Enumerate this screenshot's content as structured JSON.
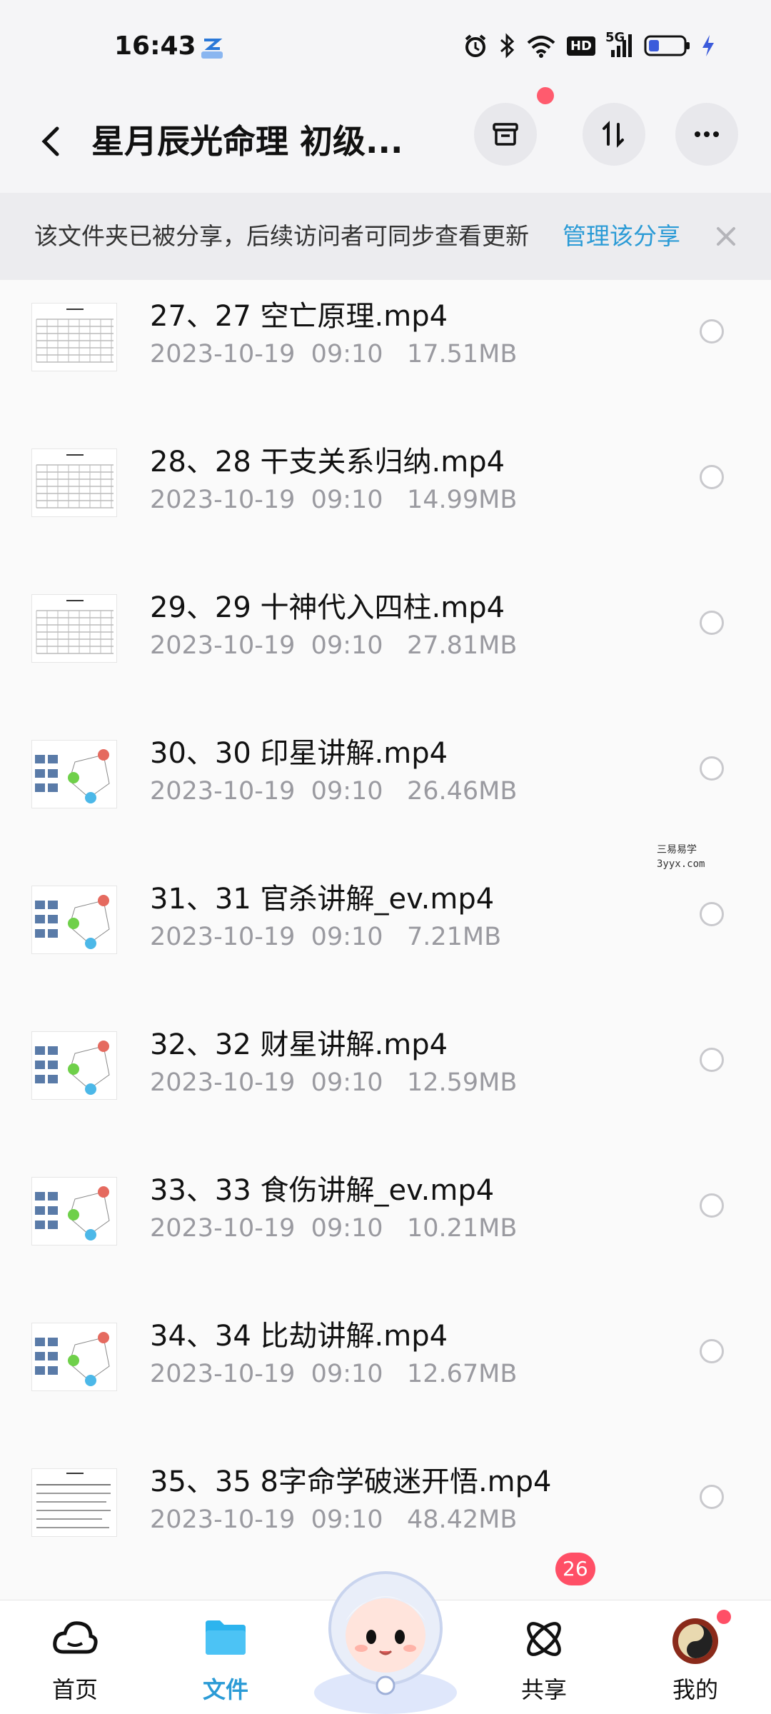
{
  "status_bar": {
    "time": "16:43",
    "icons": [
      "app-icon",
      "alarm-icon",
      "bluetooth-icon",
      "wifi-icon",
      "hd-icon",
      "5g-signal-icon",
      "battery-icon",
      "charging-icon"
    ],
    "hd_text": "HD",
    "network_text": "5G"
  },
  "header": {
    "title": "星月辰光命理 初级...",
    "icons": [
      "back-icon",
      "archive-icon",
      "sort-icon",
      "more-icon"
    ]
  },
  "banner": {
    "text": "该文件夹已被分享，后续访问者可同步查看更新",
    "link": "管理该分享",
    "close_icon": "close-icon"
  },
  "files": [
    {
      "name": "27、27 空亡原理.mp4",
      "date": "2023-10-19",
      "time": "09:10",
      "size": "17.51MB",
      "thumb": "table-thumb"
    },
    {
      "name": "28、28 干支关系归纳.mp4",
      "date": "2023-10-19",
      "time": "09:10",
      "size": "14.99MB",
      "thumb": "table-thumb"
    },
    {
      "name": "29、29 十神代入四柱.mp4",
      "date": "2023-10-19",
      "time": "09:10",
      "size": "27.81MB",
      "thumb": "table-thumb"
    },
    {
      "name": "30、30 印星讲解.mp4",
      "date": "2023-10-19",
      "time": "09:10",
      "size": "26.46MB",
      "thumb": "diagram-thumb"
    },
    {
      "name": "31、31 官杀讲解_ev.mp4",
      "date": "2023-10-19",
      "time": "09:10",
      "size": "7.21MB",
      "thumb": "diagram-thumb"
    },
    {
      "name": "32、32 财星讲解.mp4",
      "date": "2023-10-19",
      "time": "09:10",
      "size": "12.59MB",
      "thumb": "diagram-thumb"
    },
    {
      "name": "33、33 食伤讲解_ev.mp4",
      "date": "2023-10-19",
      "time": "09:10",
      "size": "10.21MB",
      "thumb": "diagram-thumb"
    },
    {
      "name": "34、34 比劫讲解.mp4",
      "date": "2023-10-19",
      "time": "09:10",
      "size": "12.67MB",
      "thumb": "diagram-thumb"
    },
    {
      "name": "35、35 8字命学破迷开悟.mp4",
      "date": "2023-10-19",
      "time": "09:10",
      "size": "48.42MB",
      "thumb": "text-thumb"
    }
  ],
  "watermark": {
    "line1": "三易易学",
    "line2": "3yyx.com"
  },
  "bottom_nav": {
    "items": [
      {
        "label": "首页",
        "icon": "home-cloud-icon",
        "active": false
      },
      {
        "label": "文件",
        "icon": "folder-icon",
        "active": true
      },
      {
        "label": "",
        "icon": "mascot-icon",
        "active": false
      },
      {
        "label": "共享",
        "icon": "share-atom-icon",
        "active": false
      },
      {
        "label": "我的",
        "icon": "avatar-icon",
        "active": false
      }
    ],
    "share_badge": "26"
  },
  "colors": {
    "accent": "#2b9bd6",
    "badge": "#ff4f66",
    "meta_text": "#9a9aa0",
    "background": "#f5f5f7"
  }
}
